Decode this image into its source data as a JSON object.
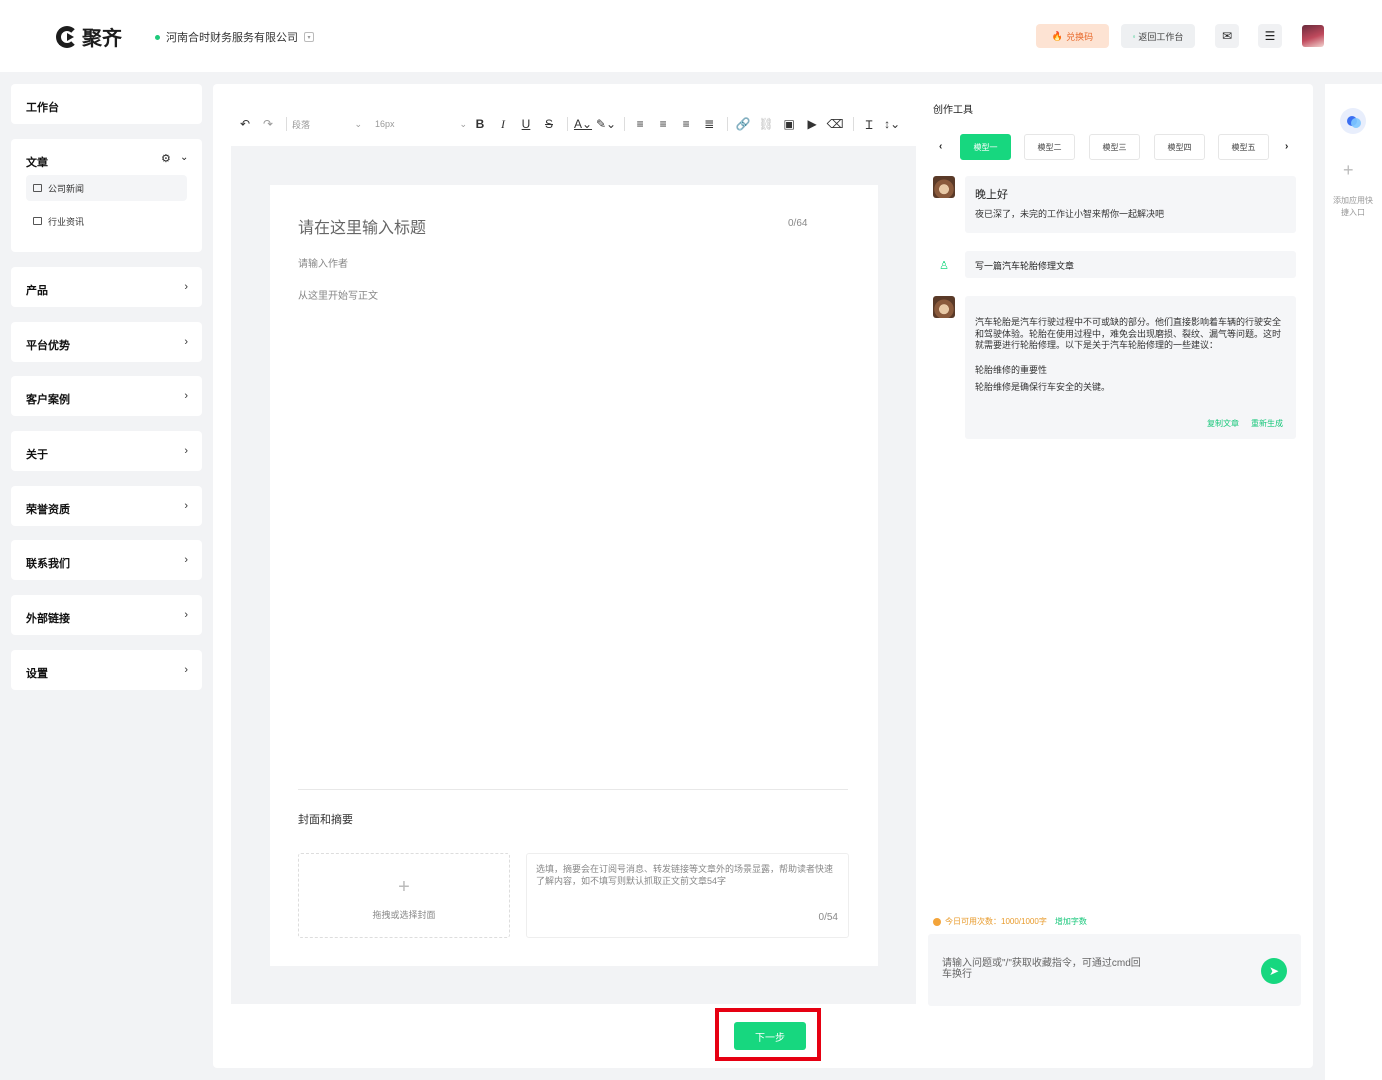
{
  "header": {
    "logo_text": "聚齐",
    "company": "河南合时财务服务有限公司",
    "company_tag": "▾",
    "redeem_label": "兑换码",
    "back_label": "返回工作台"
  },
  "sidebar": {
    "workbench": "工作台",
    "article": {
      "label": "文章",
      "items": [
        {
          "label": "公司新闻"
        },
        {
          "label": "行业资讯"
        }
      ]
    },
    "sections": [
      {
        "label": "产品"
      },
      {
        "label": "平台优势"
      },
      {
        "label": "客户案例"
      },
      {
        "label": "关于"
      },
      {
        "label": "荣誉资质"
      },
      {
        "label": "联系我们"
      },
      {
        "label": "外部链接"
      },
      {
        "label": "设置"
      }
    ]
  },
  "toolbar": {
    "style_select": "段落",
    "size_select": "16px"
  },
  "editor": {
    "title_placeholder": "请在这里输入标题",
    "title_count": "0/64",
    "author_placeholder": "请输入作者",
    "body_placeholder": "从这里开始写正文",
    "cover_title": "封面和摘要",
    "cover_drop_label": "拖拽或选择封面",
    "summary_placeholder": "选填，摘要会在订阅号消息、转发链接等文章外的场景显露，帮助读者快速了解内容，如不填写则默认抓取正文前文章54字",
    "summary_count": "0/54",
    "next_label": "下一步"
  },
  "tools": {
    "title": "创作工具",
    "tabs": [
      {
        "label": "模型一"
      },
      {
        "label": "模型二"
      },
      {
        "label": "模型三"
      },
      {
        "label": "模型四"
      },
      {
        "label": "模型五"
      }
    ],
    "greeting_title": "晚上好",
    "greeting_sub": "夜已深了，未完的工作让小智来帮你一起解决吧",
    "user_message": "写一篇汽车轮胎修理文章",
    "answer_paragraph": "汽车轮胎是汽车行驶过程中不可或缺的部分。他们直接影响着车辆的行驶安全和驾驶体验。轮胎在使用过程中，难免会出现磨损、裂纹、漏气等问题。这时就需要进行轮胎修理。以下是关于汽车轮胎修理的一些建议：",
    "answer_heading": "轮胎维修的重要性",
    "answer_line": "轮胎维修是确保行车安全的关键。",
    "copy_label": "复制文章",
    "regen_label": "重新生成",
    "quota_text": "今日可用次数：1000/1000字",
    "quota_add": "增加字数",
    "input_placeholder": "请输入问题或\"/\"获取收藏指令，可通过cmd回车换行"
  },
  "right_rail": {
    "add_app_label": "添加应用快捷入口"
  },
  "colors": {
    "accent": "#17d77f",
    "highlight_border": "#e60012"
  }
}
